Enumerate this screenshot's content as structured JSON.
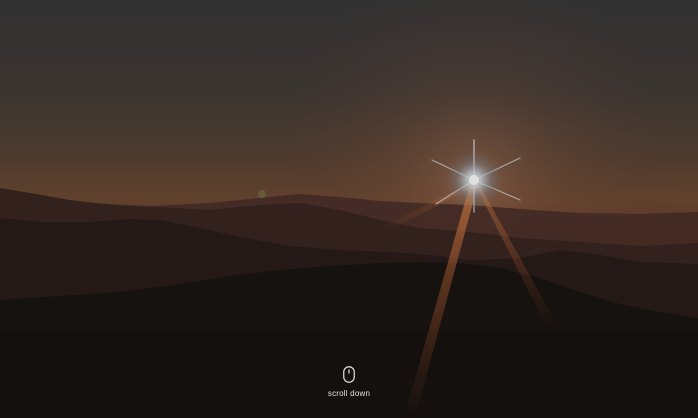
{
  "hero": {
    "image_subject": "sunset-over-mountain-ridges",
    "scroll_hint": {
      "label": "scroll down",
      "icon": "mouse-icon"
    }
  }
}
